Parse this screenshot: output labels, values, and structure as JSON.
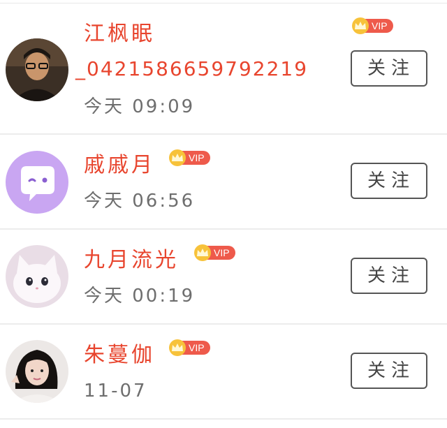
{
  "users": [
    {
      "name": "江枫眠",
      "id_line": "_0421586659792219",
      "time": "今天 09:09",
      "vip_label": "VIP",
      "follow_label": "关注",
      "avatar": "avatar-photo-man-glasses"
    },
    {
      "name": "戚戚月",
      "time": "今天 06:56",
      "vip_label": "VIP",
      "follow_label": "关注",
      "avatar": "avatar-chat-bubble"
    },
    {
      "name": "九月流光",
      "time": "今天 00:19",
      "vip_label": "VIP",
      "follow_label": "关注",
      "avatar": "avatar-white-cat"
    },
    {
      "name": "朱蔓伽",
      "time": "11-07",
      "vip_label": "VIP",
      "follow_label": "关注",
      "avatar": "avatar-photo-girl"
    }
  ],
  "colors": {
    "name": "#e8452e",
    "vip_badge": "#ee5a4b",
    "crown": "#f7c23a",
    "avatar_bubble_bg": "#c9a6f2"
  }
}
